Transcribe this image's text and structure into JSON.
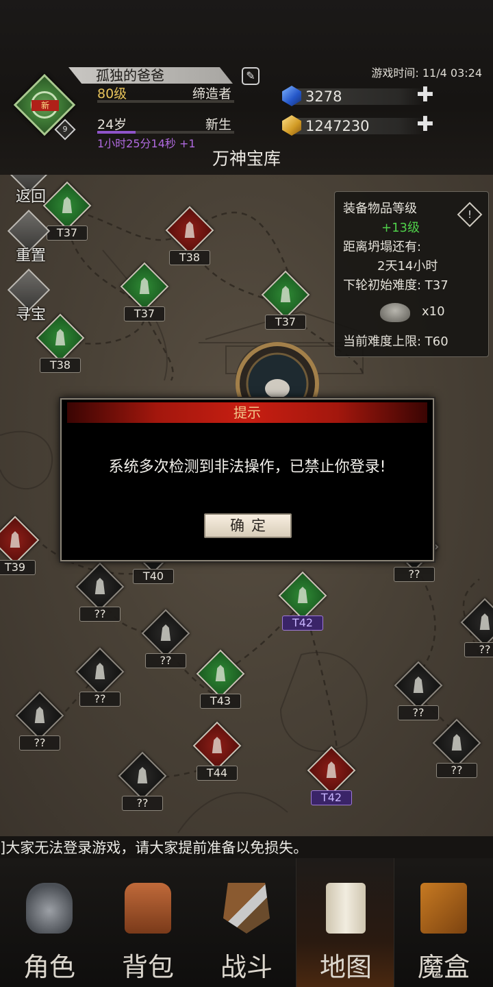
{
  "header": {
    "player_name": "孤独的爸爸",
    "new_tag": "新",
    "avatar_level": "9",
    "level": "80级",
    "title": "缔造者",
    "age": "24岁",
    "age_stage": "新生",
    "timer": "1小时25分14秒 +1",
    "game_time": "游戏时间: 11/4 03:24",
    "diamonds": "3278",
    "gold": "1247230",
    "plus_symbol": "✚",
    "page_title": "万神宝库"
  },
  "side_buttons": [
    {
      "label": "返回",
      "icon": "back-arrow-icon"
    },
    {
      "label": "重置",
      "icon": "reset-icon"
    },
    {
      "label": "寻宝",
      "icon": "skull-icon"
    }
  ],
  "info_panel": {
    "equip_level_label": "装备物品等级",
    "equip_level_value": "+13级",
    "collapse_label": "距离坍塌还有:",
    "collapse_value": "2天14小时",
    "next_difficulty": "下轮初始难度: T37",
    "altar_count": "x10",
    "max_difficulty": "当前难度上限: T60",
    "warn_symbol": "!"
  },
  "map_nodes": [
    {
      "label": "T37",
      "color": "green"
    },
    {
      "label": "T38",
      "color": "red"
    },
    {
      "label": "T37",
      "color": "green"
    },
    {
      "label": "T37",
      "color": "green"
    },
    {
      "label": "T38",
      "color": "green"
    },
    {
      "label": "T39",
      "color": "red"
    },
    {
      "label": "T40",
      "color": "dark"
    },
    {
      "label": "??",
      "color": "dark"
    },
    {
      "label": "??",
      "color": "dark"
    },
    {
      "label": "T42",
      "color": "green"
    },
    {
      "label": "??",
      "color": "dark"
    },
    {
      "label": "??",
      "color": "dark"
    },
    {
      "label": "T43",
      "color": "green"
    },
    {
      "label": "??",
      "color": "dark"
    },
    {
      "label": "??",
      "color": "dark"
    },
    {
      "label": "T44",
      "color": "red"
    },
    {
      "label": "T42",
      "color": "red"
    },
    {
      "label": "??",
      "color": "dark"
    },
    {
      "label": "??",
      "color": "dark"
    },
    {
      "label": "??",
      "color": "dark"
    }
  ],
  "modal": {
    "title": "提示",
    "message": "系统多次检测到非法操作，已禁止你登录!",
    "ok_label": "确定"
  },
  "ticker": "]大家无法登录游戏，请大家提前准备以免损失。",
  "tabs": [
    {
      "label": "角色",
      "icon": "helmet-icon"
    },
    {
      "label": "背包",
      "icon": "backpack-icon"
    },
    {
      "label": "战斗",
      "icon": "sword-shield-icon"
    },
    {
      "label": "地图",
      "icon": "scroll-map-icon",
      "active": true
    },
    {
      "label": "魔盒",
      "icon": "magic-box-icon"
    }
  ],
  "colors": {
    "level_gold": "#e7c35a",
    "timer_purple": "#b06ae0",
    "bonus_green": "#4fd04a",
    "modal_red": "#c71e12"
  }
}
